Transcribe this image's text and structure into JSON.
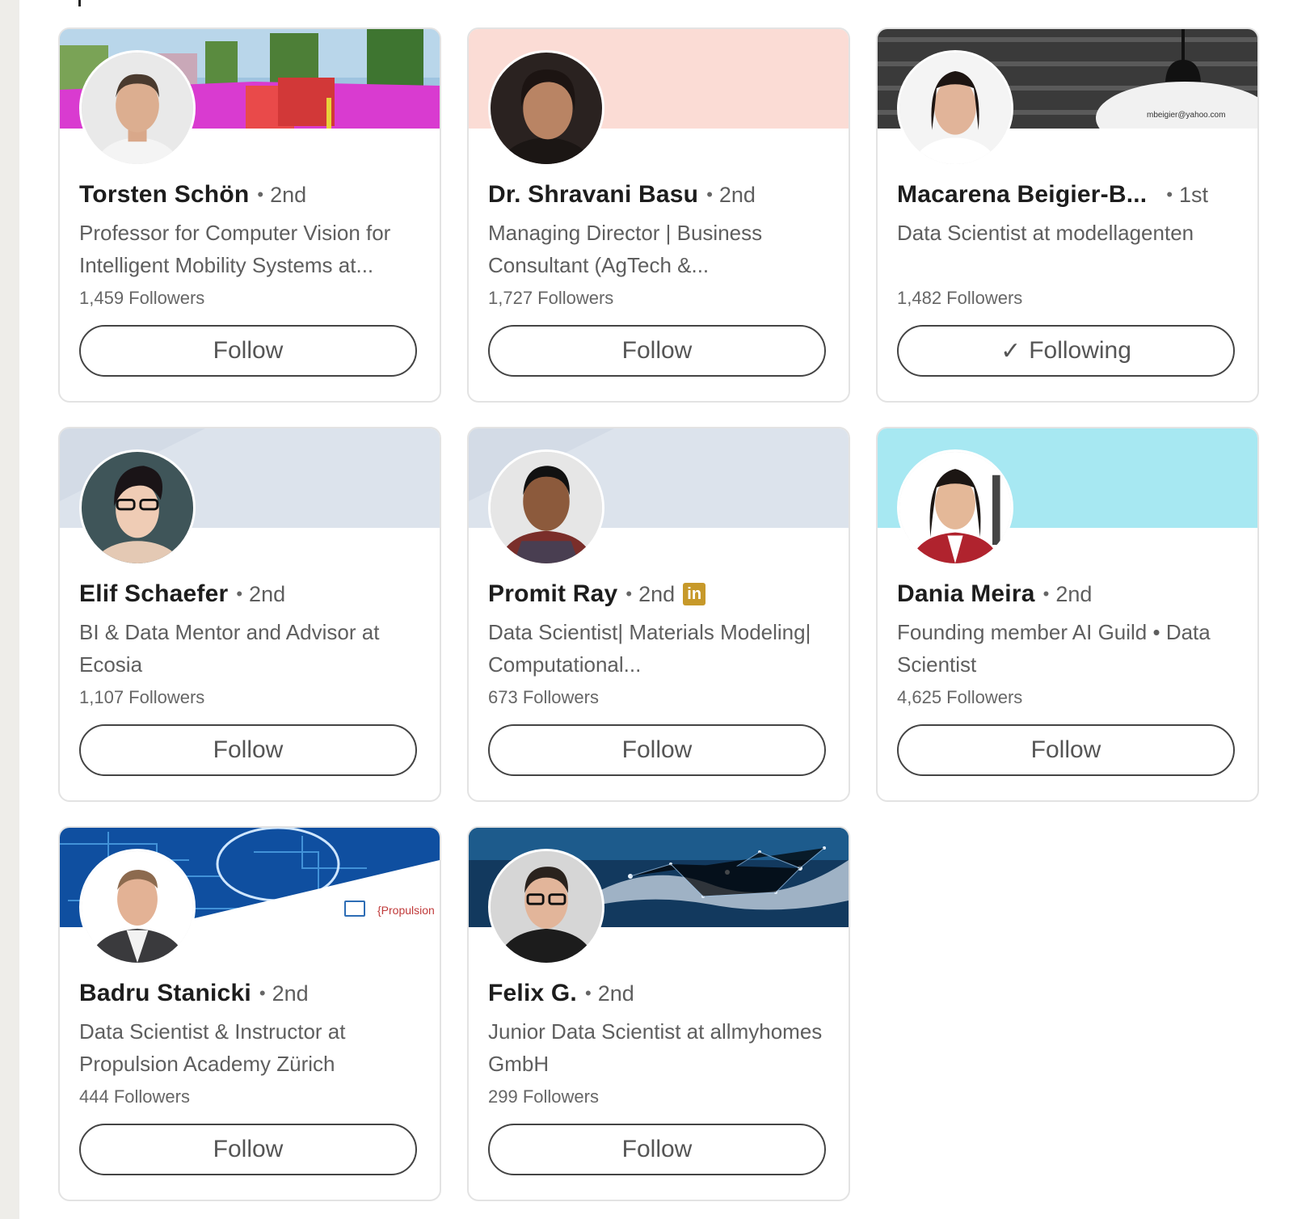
{
  "profiles": [
    {
      "name": "Torsten Schön",
      "degree": "2nd",
      "headline": "Professor for Computer Vision for Intelligent Mobility Systems at...",
      "followers": "1,459 Followers",
      "button": "Follow",
      "following": false
    },
    {
      "name": "Dr. Shravani Basu",
      "degree": "2nd",
      "headline": "Managing Director | Business Consultant (AgTech &...",
      "followers": "1,727 Followers",
      "button": "Follow",
      "following": false
    },
    {
      "name": "Macarena Beigier-B...",
      "degree": "1st",
      "headline": "Data Scientist at modellagenten",
      "followers": "1,482 Followers",
      "button": "Following",
      "following": true,
      "button_icon": "checkmark-icon",
      "banner_text": "mbeigier@yahoo.com"
    },
    {
      "name": "Elif Schaefer",
      "degree": "2nd",
      "headline": "BI & Data Mentor and Advisor at Ecosia",
      "followers": "1,107 Followers",
      "button": "Follow",
      "following": false
    },
    {
      "name": "Promit Ray",
      "degree": "2nd",
      "headline": "Data Scientist| Materials Modeling| Computational...",
      "followers": "673 Followers",
      "button": "Follow",
      "following": false,
      "badge": "in"
    },
    {
      "name": "Dania Meira",
      "degree": "2nd",
      "headline": "Founding member AI Guild • Data Scientist",
      "followers": "4,625 Followers",
      "button": "Follow",
      "following": false
    },
    {
      "name": "Badru Stanicki",
      "degree": "2nd",
      "headline": "Data Scientist & Instructor at Propulsion Academy Zürich",
      "followers": "444 Followers",
      "button": "Follow",
      "following": false,
      "banner_text": "{Propulsion"
    },
    {
      "name": "Felix G.",
      "degree": "2nd",
      "headline": "Junior Data Scientist at allmyhomes GmbH",
      "followers": "299 Followers",
      "button": "Follow",
      "following": false
    }
  ],
  "dot_separator": "•",
  "colors": {
    "badge_gold": "#c7992a",
    "banner_pink": "#fbdcd5",
    "banner_grey_blue": "#dce3ec",
    "banner_cyan": "#a7e8f2"
  }
}
